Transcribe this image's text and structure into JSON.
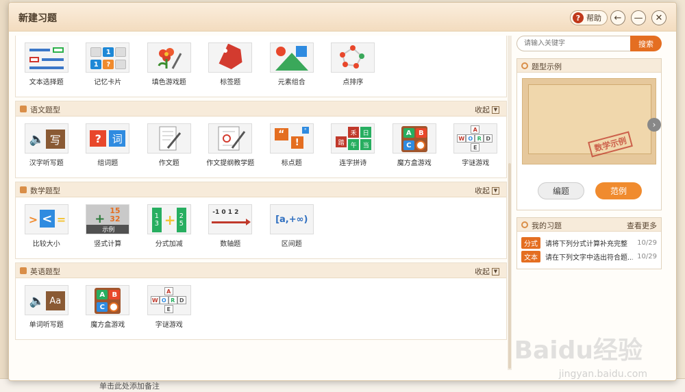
{
  "dialog": {
    "title": "新建习题",
    "help_label": "帮助",
    "back_icon": "back-arrow-icon",
    "minimize_icon": "minimize-icon",
    "close_icon": "close-icon"
  },
  "sections": [
    {
      "title": "",
      "collapse": "",
      "items": [
        {
          "label": "文本选择题",
          "icon": "text-choice-icon"
        },
        {
          "label": "记忆卡片",
          "icon": "memory-card-icon"
        },
        {
          "label": "填色游戏题",
          "icon": "color-game-icon"
        },
        {
          "label": "标签题",
          "icon": "tag-icon"
        },
        {
          "label": "元素组合",
          "icon": "shape-combine-icon"
        },
        {
          "label": "点排序",
          "icon": "dot-sort-icon"
        }
      ]
    },
    {
      "title": "语文题型",
      "collapse": "收起",
      "items": [
        {
          "label": "汉字听写题",
          "icon": "hanzi-dictation-icon",
          "glyph": "写"
        },
        {
          "label": "组词题",
          "icon": "word-building-icon",
          "glyph": "词"
        },
        {
          "label": "作文题",
          "icon": "essay-icon"
        },
        {
          "label": "作文提纲教学题",
          "icon": "essay-outline-icon"
        },
        {
          "label": "标点题",
          "icon": "punctuation-icon"
        },
        {
          "label": "连字拼诗",
          "icon": "poem-link-icon",
          "glyph": "日"
        },
        {
          "label": "魔方盒游戏",
          "icon": "magic-box-icon"
        },
        {
          "label": "字谜游戏",
          "icon": "word-puzzle-icon"
        }
      ]
    },
    {
      "title": "数学题型",
      "collapse": "收起",
      "items": [
        {
          "label": "比较大小",
          "icon": "compare-icon"
        },
        {
          "label": "竖式计算",
          "icon": "vertical-calc-icon",
          "overlay": "示例"
        },
        {
          "label": "分式加减",
          "icon": "fraction-icon"
        },
        {
          "label": "数轴题",
          "icon": "number-line-icon",
          "glyph": "-1 0 1 2"
        },
        {
          "label": "区间题",
          "icon": "interval-icon",
          "glyph": "[a,+∞)"
        }
      ]
    },
    {
      "title": "英语题型",
      "collapse": "收起",
      "items": [
        {
          "label": "单词听写题",
          "icon": "word-dictation-icon",
          "glyph": "Aa"
        },
        {
          "label": "魔方盒游戏",
          "icon": "magic-box-icon"
        },
        {
          "label": "字谜游戏",
          "icon": "word-puzzle-icon"
        }
      ]
    }
  ],
  "search": {
    "placeholder": "请输入关键字",
    "button": "搜索"
  },
  "preview_panel": {
    "title": "题型示例",
    "stamp": "数学示例",
    "edit_button": "编题",
    "example_button": "范例"
  },
  "my_panel": {
    "title": "我的习题",
    "more": "查看更多",
    "rows": [
      {
        "tag": "分式",
        "text": "请将下列分式计算补充完整",
        "date": "10/29"
      },
      {
        "tag": "文本",
        "text": "请在下列文字中选出符合题...",
        "date": "10/29"
      }
    ]
  },
  "background": {
    "note": "单击此处添加备注",
    "watermark": "Baidu经验",
    "watermark_url": "jingyan.baidu.com"
  },
  "colors": {
    "accent": "#e46e21",
    "header_bg": "#f7ebda",
    "title_bar": "#f3dcbf"
  }
}
